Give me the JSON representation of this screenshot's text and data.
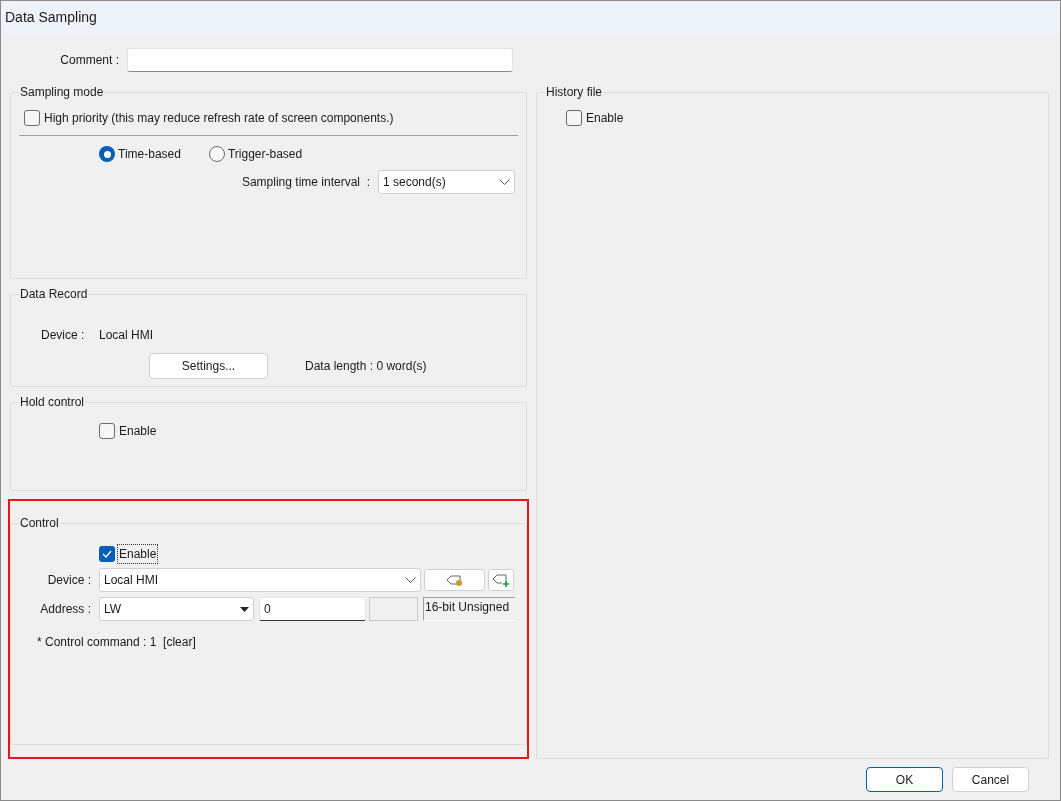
{
  "window": {
    "title": "Data Sampling"
  },
  "comment": {
    "label": "Comment :"
  },
  "sampling_mode": {
    "title": "Sampling mode",
    "high_priority": {
      "label": "High priority (this may reduce refresh rate of screen components.)",
      "checked": false
    },
    "modes": [
      {
        "label": "Time-based",
        "selected": true
      },
      {
        "label": "Trigger-based",
        "selected": false
      }
    ],
    "interval": {
      "label": "Sampling time interval  :",
      "value": "1 second(s)"
    }
  },
  "data_record": {
    "title": "Data Record",
    "device_label": "Device :",
    "device_value": "Local HMI",
    "settings_button": "Settings...",
    "data_length": "Data length : 0 word(s)"
  },
  "hold_control": {
    "title": "Hold control",
    "enable": {
      "label": "Enable",
      "checked": false
    }
  },
  "control": {
    "title": "Control",
    "enable": {
      "label": "Enable",
      "checked": true
    },
    "device": {
      "label": "Device :",
      "value": "Local HMI"
    },
    "address": {
      "label": "Address :",
      "type": "LW",
      "value": "0",
      "data_type": "16-bit Unsigned"
    },
    "note": "* Control command : 1  [clear]"
  },
  "history_file": {
    "title": "History file",
    "enable": {
      "label": "Enable",
      "checked": false
    }
  },
  "buttons": [
    {
      "label": "OK",
      "default": true
    },
    {
      "label": "Cancel",
      "default": false
    }
  ]
}
